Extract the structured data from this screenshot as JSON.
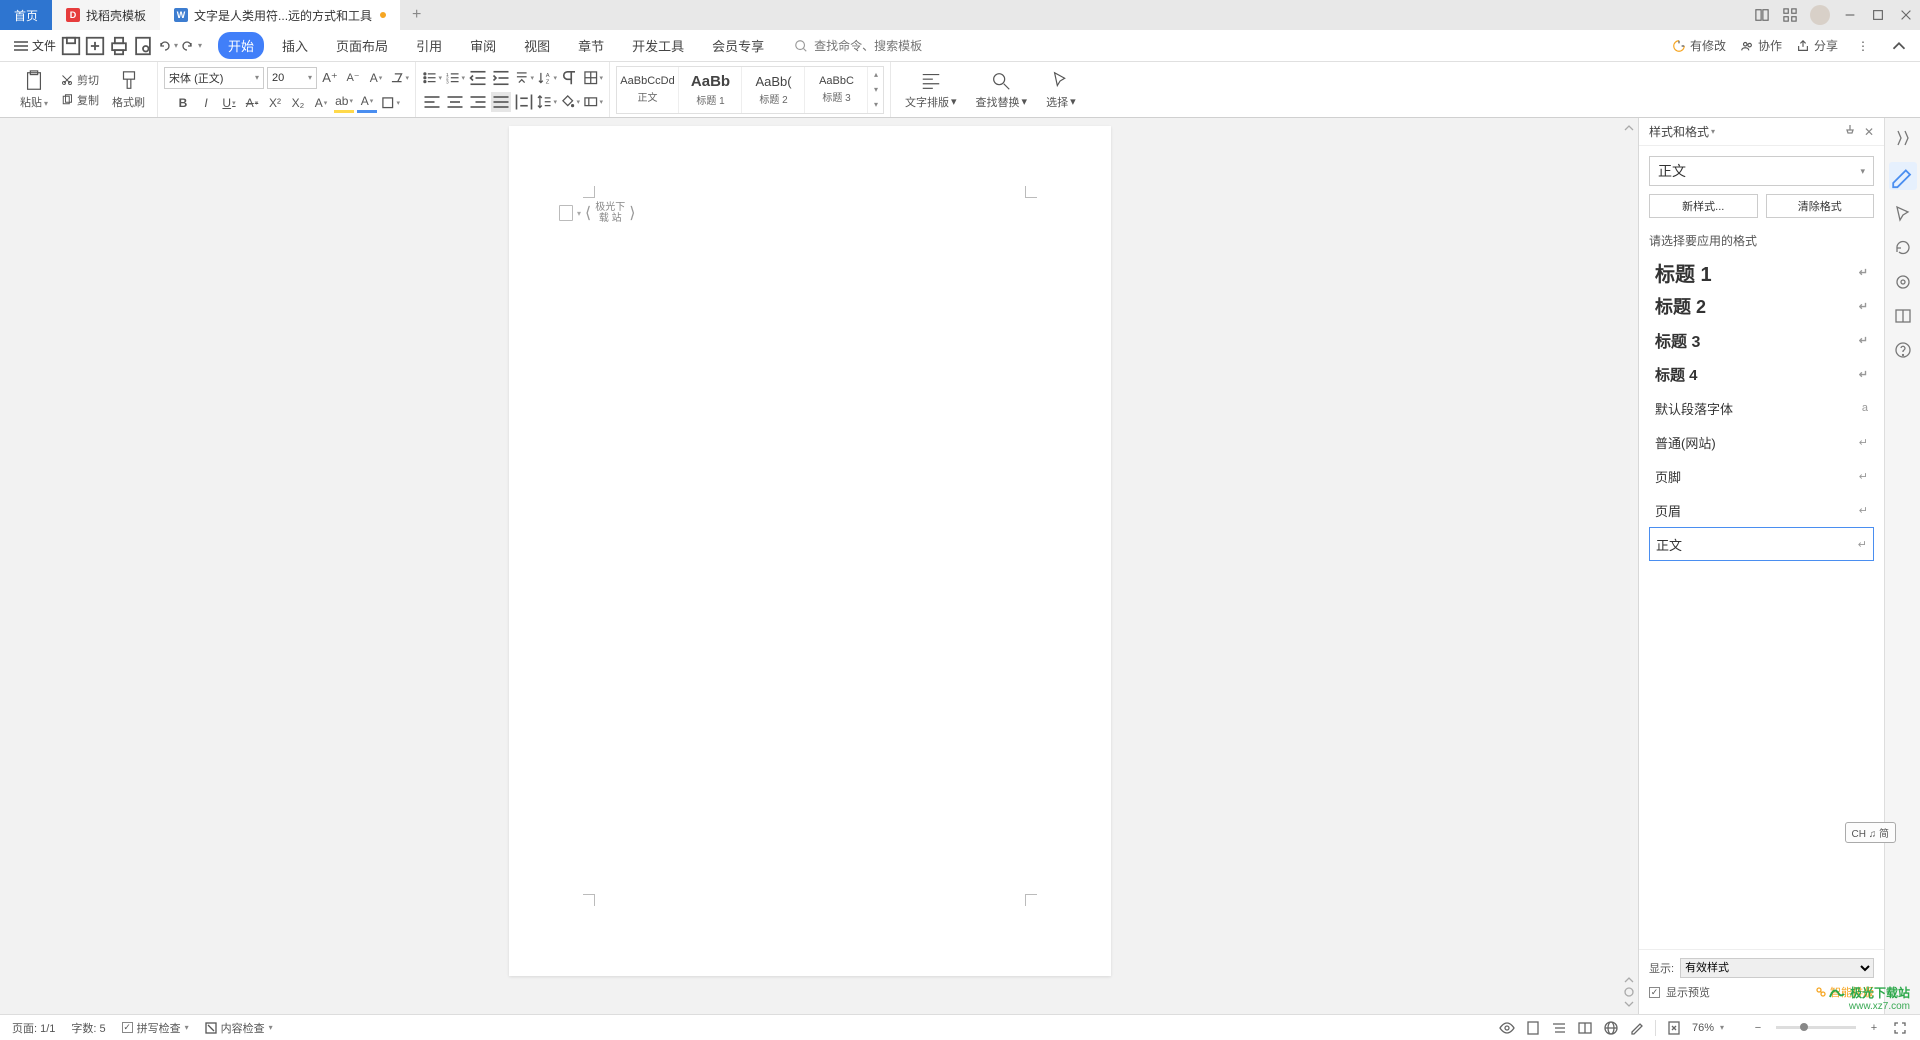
{
  "tabs": {
    "home": "首页",
    "template": "找稻壳模板",
    "doc": "文字是人类用符...远的方式和工具"
  },
  "menubar": {
    "file": "文件",
    "items": [
      "开始",
      "插入",
      "页面布局",
      "引用",
      "审阅",
      "视图",
      "章节",
      "开发工具",
      "会员专享"
    ],
    "search_placeholder": "查找命令、搜索模板",
    "right": {
      "changes": "有修改",
      "collab": "协作",
      "share": "分享"
    }
  },
  "ribbon": {
    "paste": "粘贴",
    "cut": "剪切",
    "copy": "复制",
    "format_painter": "格式刷",
    "font_name": "宋体 (正文)",
    "font_size": "20",
    "styles": {
      "body": "正文",
      "h1": "标题 1",
      "h2": "标题 2",
      "h3": "标题 3"
    },
    "text_layout": "文字排版",
    "find_replace": "查找替换",
    "select": "选择"
  },
  "doc_content": {
    "line1": "极光下",
    "line2": "载 站"
  },
  "panel": {
    "title": "样式和格式",
    "current": "正文",
    "new_style": "新样式...",
    "clear_format": "清除格式",
    "apply_label": "请选择要应用的格式",
    "styles": [
      {
        "name": "标题 1",
        "cls": "h1"
      },
      {
        "name": "标题 2",
        "cls": "h2"
      },
      {
        "name": "标题 3",
        "cls": "h3"
      },
      {
        "name": "标题 4",
        "cls": "h4"
      },
      {
        "name": "默认段落字体",
        "cls": "",
        "mark": "a"
      },
      {
        "name": "普通(网站)",
        "cls": ""
      },
      {
        "name": "页脚",
        "cls": ""
      },
      {
        "name": "页眉",
        "cls": ""
      },
      {
        "name": "正文",
        "cls": "",
        "selected": true
      }
    ],
    "show_label": "显示:",
    "show_value": "有效样式",
    "preview_check": "显示预览",
    "smart_layout": "智能排版"
  },
  "ime": "CH ♫ 简",
  "status": {
    "page": "页面: 1/1",
    "words": "字数: 5",
    "spell": "拼写检查",
    "content": "内容检查",
    "zoom": "76%"
  },
  "watermark": {
    "name": "极光下载站",
    "url": "www.xz7.com"
  }
}
